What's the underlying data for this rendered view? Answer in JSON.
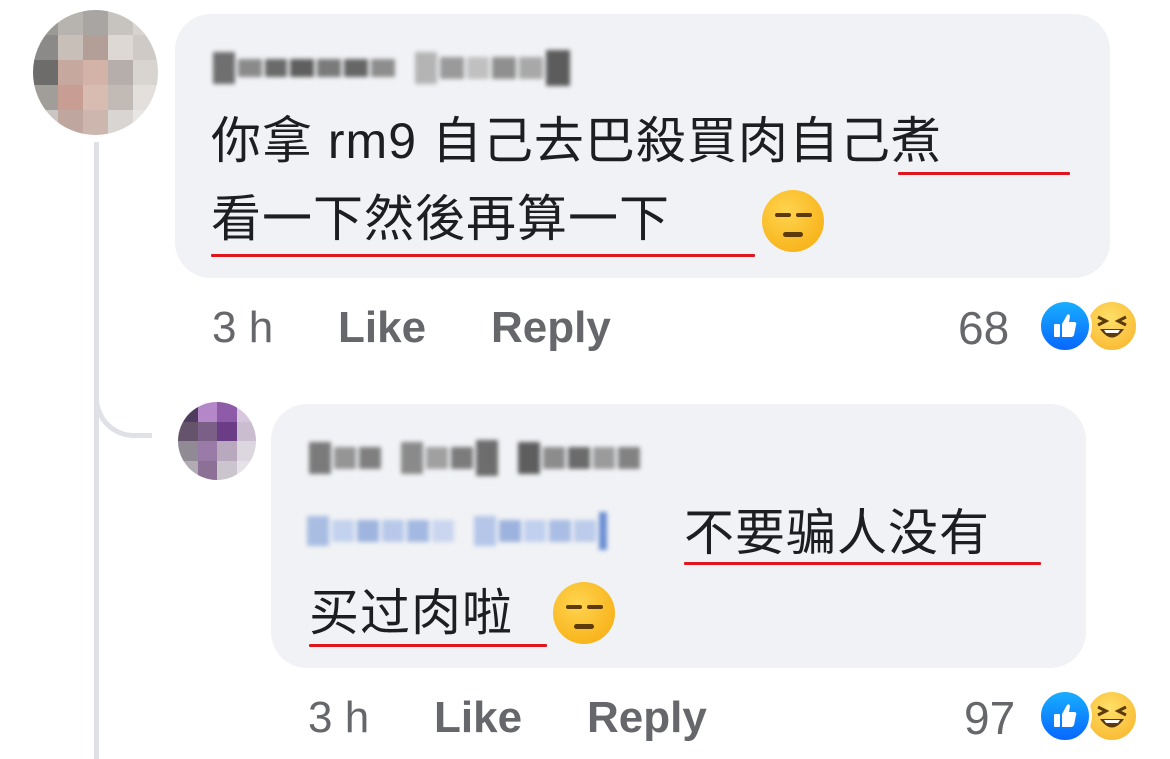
{
  "comments": [
    {
      "text_line1": "你拿 rm9 自己去巴殺買肉自己煮",
      "text_line2": "看一下然後再算一下",
      "emoji": "unamused-face-emoji",
      "time": "3 h",
      "like_label": "Like",
      "reply_label": "Reply",
      "reaction_count": "68",
      "reactions": [
        "like-reaction-icon",
        "haha-reaction-icon"
      ]
    },
    {
      "text_line1": "不要骗人没有",
      "text_line2": "买过肉啦",
      "emoji": "unamused-face-emoji",
      "time": "3 h",
      "like_label": "Like",
      "reply_label": "Reply",
      "reaction_count": "97",
      "reactions": [
        "like-reaction-icon",
        "haha-reaction-icon"
      ]
    }
  ],
  "colors": {
    "bubble": "#f0f2f5",
    "underline": "#e0161f",
    "meta_text": "#65676b",
    "mention": "#385898"
  }
}
